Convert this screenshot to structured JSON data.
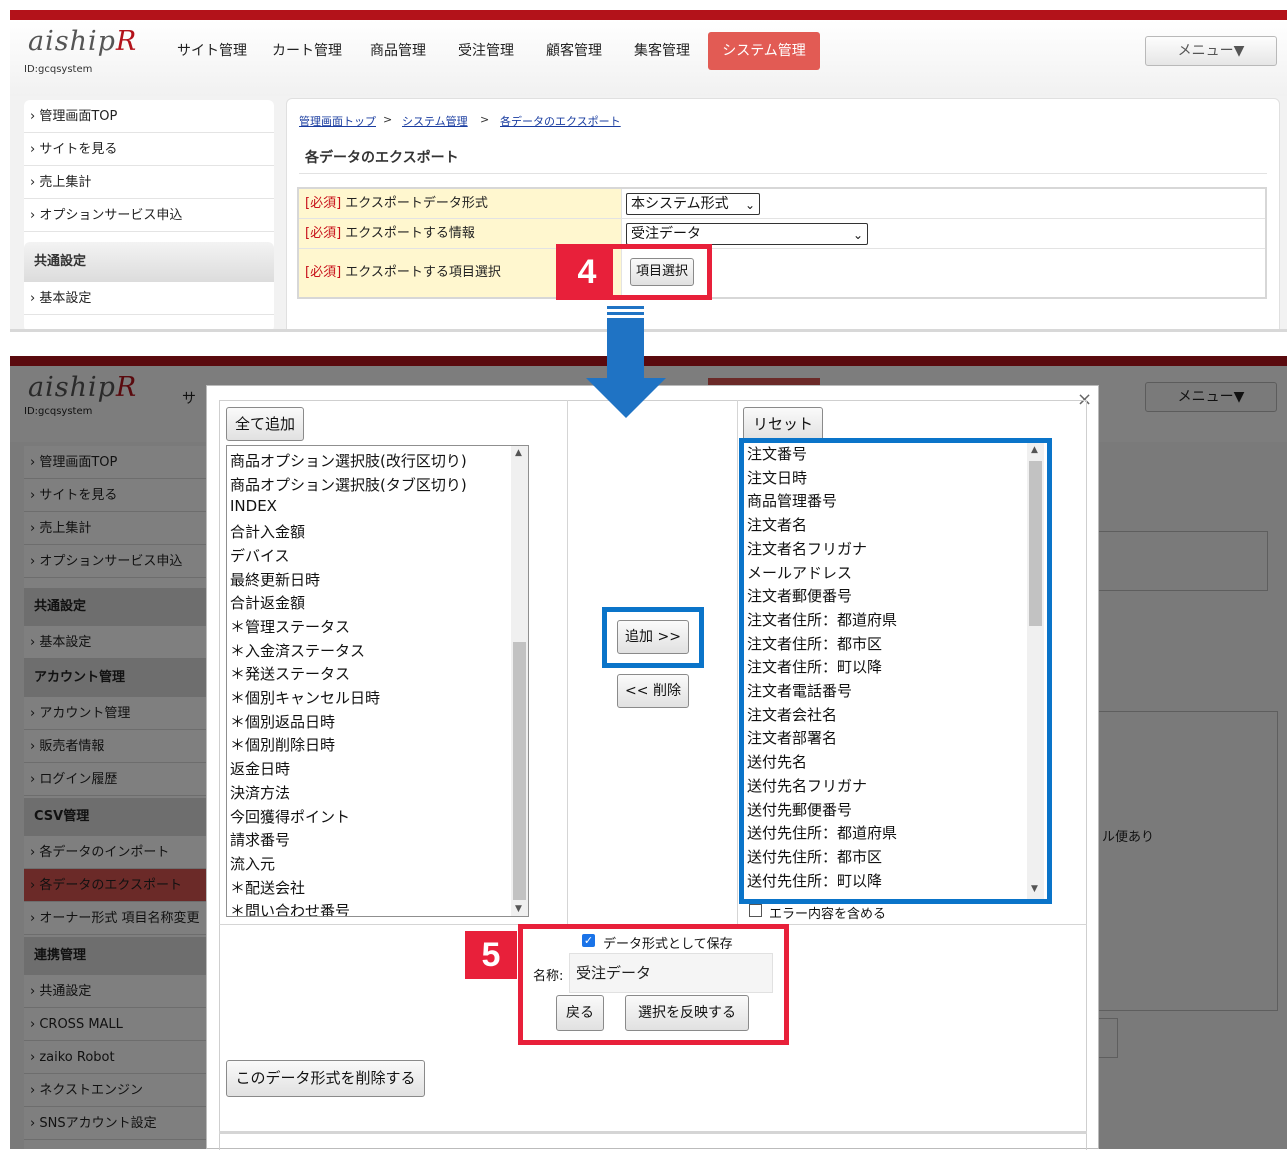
{
  "app": {
    "logo": "aiship",
    "logo_suffix": "R",
    "site_id": "ID:gcqsystem"
  },
  "nav": {
    "items": [
      "サイト管理",
      "カート管理",
      "商品管理",
      "受注管理",
      "顧客管理",
      "集客管理",
      "システム管理"
    ],
    "active": "システム管理",
    "menu_button": "メニュー▼"
  },
  "sidebar_top": {
    "items": [
      "管理画面TOP",
      "サイトを見る",
      "売上集計",
      "オプションサービス申込"
    ],
    "section": "共通設定",
    "section_items": [
      "基本設定"
    ]
  },
  "breadcrumb": {
    "items": [
      "管理画面トップ",
      "システム管理",
      "各データのエクスポート"
    ],
    "separator": ">"
  },
  "page_title": "各データのエクスポート",
  "form": {
    "required_tag": "[必須]",
    "rows": [
      {
        "label": "エクスポートデータ形式",
        "value": "本システム形式"
      },
      {
        "label": "エクスポートする情報",
        "value": "受注データ"
      },
      {
        "label": "エクスポートする項目選択",
        "button": "項目選択"
      }
    ]
  },
  "steps": {
    "step4": "4",
    "step5": "5"
  },
  "sidebar_bottom": {
    "top_items": [
      "管理画面TOP",
      "サイトを見る",
      "売上集計",
      "オプションサービス申込"
    ],
    "sections": [
      {
        "title": "共通設定",
        "items": [
          "基本設定"
        ]
      },
      {
        "title": "アカウント管理",
        "items": [
          "アカウント管理",
          "販売者情報",
          "ログイン履歴"
        ]
      },
      {
        "title": "CSV管理",
        "items": [
          "各データのインポート",
          "各データのエクスポート",
          "オーナー形式 項目名称変更"
        ]
      },
      {
        "title": "連携管理",
        "items": [
          "共通設定",
          "CROSS MALL",
          "zaiko Robot",
          "ネクストエンジン",
          "SNSアカウント設定"
        ]
      }
    ],
    "bg_text": "ル便あり"
  },
  "dialog": {
    "close_icon": "×",
    "add_all_button": "全て追加",
    "reset_button": "リセット",
    "add_button": "追加 >>",
    "remove_button": "<< 削除",
    "available_items": [
      "商品オプション選択肢(改行区切り)",
      "商品オプション選択肢(タブ区切り)",
      "INDEX",
      "合計入金額",
      "デバイス",
      "最終更新日時",
      "合計返金額",
      "＊管理ステータス",
      "＊入金済ステータス",
      "＊発送ステータス",
      "＊個別キャンセル日時",
      "＊個別返品日時",
      "＊個別削除日時",
      "返金日時",
      "決済方法",
      "今回獲得ポイント",
      "請求番号",
      "流入元",
      "＊配送会社",
      "＊問い合わせ番号"
    ],
    "selected_items": [
      "注文番号",
      "注文日時",
      "商品管理番号",
      "注文者名",
      "注文者名フリガナ",
      "メールアドレス",
      "注文者郵便番号",
      "注文者住所：都道府県",
      "注文者住所：都市区",
      "注文者住所：町以降",
      "注文者電話番号",
      "注文者会社名",
      "注文者部署名",
      "送付先名",
      "送付先名フリガナ",
      "送付先郵便番号",
      "送付先住所：都道府県",
      "送付先住所：都市区",
      "送付先住所：町以降"
    ],
    "include_errors_label": "エラー内容を含める",
    "include_errors_checked": false,
    "save_format_label": "データ形式として保存",
    "save_format_checked": true,
    "name_label": "名称:",
    "name_value": "受注データ",
    "back_button": "戻る",
    "apply_button": "選択を反映する",
    "delete_format_button": "このデータ形式を削除する"
  },
  "colors": {
    "brand_red": "#b3121a",
    "nav_active": "#e25b54",
    "callout_red": "#e8203a",
    "callout_blue": "#0a74c9",
    "required_red": "#c8101a",
    "label_bg": "#fff7cf"
  }
}
